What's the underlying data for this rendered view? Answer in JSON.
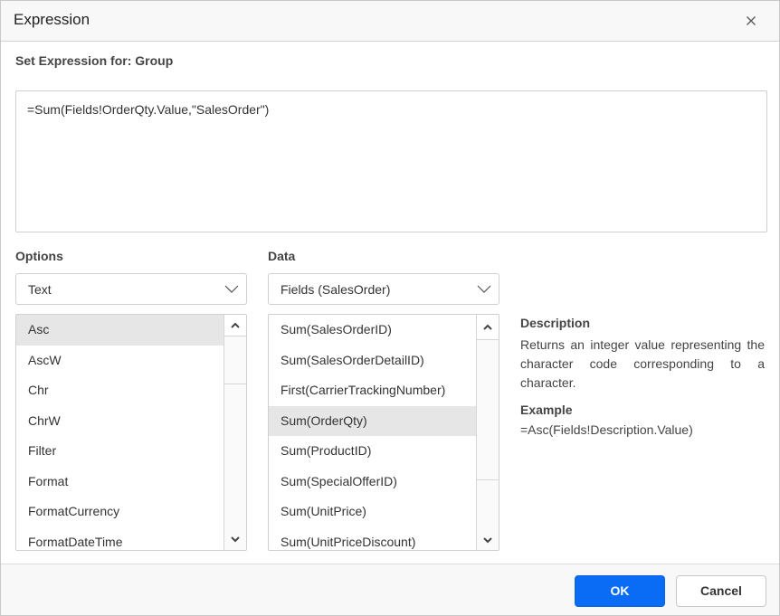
{
  "dialog": {
    "title": "Expression",
    "close_icon": "close-icon"
  },
  "expression": {
    "label": "Set Expression for: Group",
    "value": "=Sum(Fields!OrderQty.Value,\"SalesOrder\")"
  },
  "options": {
    "label": "Options",
    "selected": "Text",
    "items": [
      {
        "label": "Asc",
        "selected": true
      },
      {
        "label": "AscW",
        "selected": false
      },
      {
        "label": "Chr",
        "selected": false
      },
      {
        "label": "ChrW",
        "selected": false
      },
      {
        "label": "Filter",
        "selected": false
      },
      {
        "label": "Format",
        "selected": false
      },
      {
        "label": "FormatCurrency",
        "selected": false
      },
      {
        "label": "FormatDateTime",
        "selected": false
      }
    ]
  },
  "data": {
    "label": "Data",
    "selected": "Fields (SalesOrder)",
    "items": [
      {
        "label": "Sum(SalesOrderID)",
        "selected": false
      },
      {
        "label": "Sum(SalesOrderDetailID)",
        "selected": false
      },
      {
        "label": "First(CarrierTrackingNumber)",
        "selected": false
      },
      {
        "label": "Sum(OrderQty)",
        "selected": true
      },
      {
        "label": "Sum(ProductID)",
        "selected": false
      },
      {
        "label": "Sum(SpecialOfferID)",
        "selected": false
      },
      {
        "label": "Sum(UnitPrice)",
        "selected": false
      },
      {
        "label": "Sum(UnitPriceDiscount)",
        "selected": false
      }
    ]
  },
  "info": {
    "description_title": "Description",
    "description_text": "Returns an integer value representing the character code corresponding to a character.",
    "example_title": "Example",
    "example_text": "=Asc(Fields!Description.Value)"
  },
  "footer": {
    "ok_label": "OK",
    "cancel_label": "Cancel"
  },
  "colors": {
    "primary": "#0a6cf5",
    "selected_row": "#e6e6e6"
  }
}
